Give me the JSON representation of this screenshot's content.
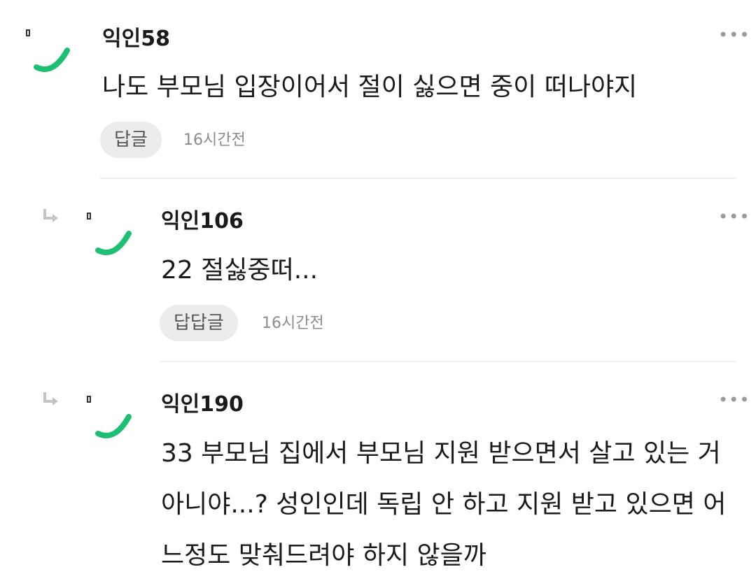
{
  "comments": [
    {
      "author": "익인58",
      "text": "나도 부모님 입장이어서 절이 싫으면 중이 떠나야지",
      "reply_label": "답글",
      "time": "16시간전",
      "more_icon": "more-icon"
    },
    {
      "author": "익인106",
      "text": "22 절싫중떠...",
      "reply_label": "답답글",
      "time": "16시간전",
      "more_icon": "more-icon"
    },
    {
      "author": "익인190",
      "text": "33 부모님 집에서 부모님 지원 받으면서 살고 있는 거 아니야...? 성인인데 독립 안 하고 지원 받고 있으면 어느정도 맞춰드려야 하지 않을까",
      "more_icon": "more-icon"
    }
  ],
  "colors": {
    "avatar_accent": "#1dbf73",
    "reply_button_bg": "#ececec",
    "muted_text": "#8c8c8c"
  }
}
